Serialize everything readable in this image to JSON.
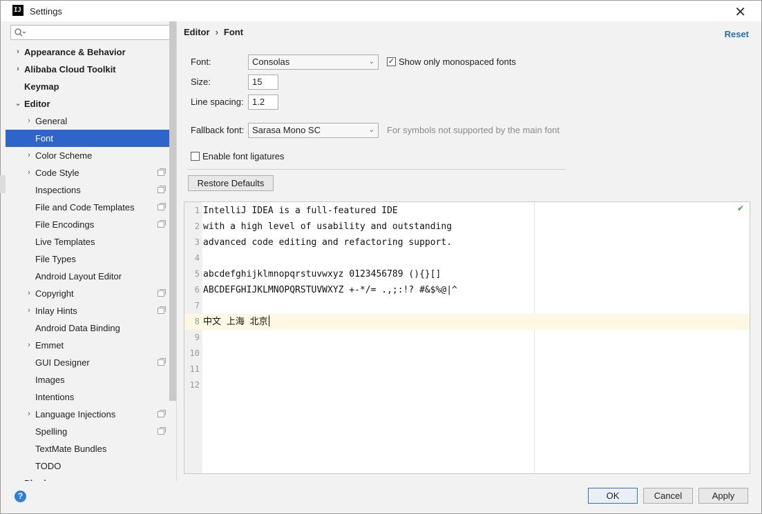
{
  "window": {
    "title": "Settings",
    "app_icon_text": "IJ",
    "close": "✕"
  },
  "search": {
    "placeholder": ""
  },
  "sidebar": {
    "items": [
      {
        "label": "Appearance & Behavior",
        "level": 0,
        "bold": true,
        "arrow": "›",
        "icon": false
      },
      {
        "label": "Alibaba Cloud Toolkit",
        "level": 0,
        "bold": true,
        "arrow": "›",
        "icon": false
      },
      {
        "label": "Keymap",
        "level": 0,
        "bold": true,
        "arrow": "",
        "icon": false
      },
      {
        "label": "Editor",
        "level": 0,
        "bold": true,
        "arrow": "⌄",
        "icon": false
      },
      {
        "label": "General",
        "level": 1,
        "bold": false,
        "arrow": "›",
        "icon": false
      },
      {
        "label": "Font",
        "level": 1,
        "bold": false,
        "arrow": "",
        "icon": false,
        "selected": true
      },
      {
        "label": "Color Scheme",
        "level": 1,
        "bold": false,
        "arrow": "›",
        "icon": false
      },
      {
        "label": "Code Style",
        "level": 1,
        "bold": false,
        "arrow": "›",
        "icon": true
      },
      {
        "label": "Inspections",
        "level": 1,
        "bold": false,
        "arrow": "",
        "icon": true
      },
      {
        "label": "File and Code Templates",
        "level": 1,
        "bold": false,
        "arrow": "",
        "icon": true
      },
      {
        "label": "File Encodings",
        "level": 1,
        "bold": false,
        "arrow": "",
        "icon": true
      },
      {
        "label": "Live Templates",
        "level": 1,
        "bold": false,
        "arrow": "",
        "icon": false
      },
      {
        "label": "File Types",
        "level": 1,
        "bold": false,
        "arrow": "",
        "icon": false
      },
      {
        "label": "Android Layout Editor",
        "level": 1,
        "bold": false,
        "arrow": "",
        "icon": false
      },
      {
        "label": "Copyright",
        "level": 1,
        "bold": false,
        "arrow": "›",
        "icon": true
      },
      {
        "label": "Inlay Hints",
        "level": 1,
        "bold": false,
        "arrow": "›",
        "icon": true
      },
      {
        "label": "Android Data Binding",
        "level": 1,
        "bold": false,
        "arrow": "",
        "icon": false
      },
      {
        "label": "Emmet",
        "level": 1,
        "bold": false,
        "arrow": "›",
        "icon": false
      },
      {
        "label": "GUI Designer",
        "level": 1,
        "bold": false,
        "arrow": "",
        "icon": true
      },
      {
        "label": "Images",
        "level": 1,
        "bold": false,
        "arrow": "",
        "icon": false
      },
      {
        "label": "Intentions",
        "level": 1,
        "bold": false,
        "arrow": "",
        "icon": false
      },
      {
        "label": "Language Injections",
        "level": 1,
        "bold": false,
        "arrow": "›",
        "icon": true
      },
      {
        "label": "Spelling",
        "level": 1,
        "bold": false,
        "arrow": "",
        "icon": true
      },
      {
        "label": "TextMate Bundles",
        "level": 1,
        "bold": false,
        "arrow": "",
        "icon": false
      },
      {
        "label": "TODO",
        "level": 1,
        "bold": false,
        "arrow": "",
        "icon": false
      },
      {
        "label": "Plugins",
        "level": 0,
        "bold": true,
        "arrow": "",
        "icon": false
      }
    ]
  },
  "breadcrumb": {
    "parent": "Editor",
    "separator": "›",
    "current": "Font"
  },
  "reset_label": "Reset",
  "font": {
    "font_label": "Font:",
    "font_value": "Consolas",
    "show_mono_label": "Show only monospaced fonts",
    "show_mono_checked": "✓",
    "size_label": "Size:",
    "size_value": "15",
    "line_spacing_label": "Line spacing:",
    "line_spacing_value": "1.2",
    "fallback_label": "Fallback font:",
    "fallback_value": "Sarasa Mono SC",
    "fallback_hint": "For symbols not supported by the main font",
    "ligatures_label": "Enable font ligatures",
    "restore_label": "Restore Defaults"
  },
  "preview": {
    "lines": [
      {
        "n": "1",
        "text": "IntelliJ IDEA is a full-featured IDE"
      },
      {
        "n": "2",
        "text": "with a high level of usability and outstanding"
      },
      {
        "n": "3",
        "text": "advanced code editing and refactoring support."
      },
      {
        "n": "4",
        "text": ""
      },
      {
        "n": "5",
        "text": "abcdefghijklmnopqrstuvwxyz 0123456789 (){}[]"
      },
      {
        "n": "6",
        "text": "ABCDEFGHIJKLMNOPQRSTUVWXYZ +-*/= .,;:!? #&$%@|^"
      },
      {
        "n": "7",
        "text": ""
      },
      {
        "n": "8",
        "text": "中文 上海 北京",
        "current": true
      },
      {
        "n": "9",
        "text": ""
      },
      {
        "n": "10",
        "text": ""
      },
      {
        "n": "11",
        "text": ""
      },
      {
        "n": "12",
        "text": ""
      }
    ],
    "inspect_icon": "✔"
  },
  "buttons": {
    "ok": "OK",
    "cancel": "Cancel",
    "apply": "Apply"
  },
  "help": "?",
  "left_edge_glyph": "t"
}
